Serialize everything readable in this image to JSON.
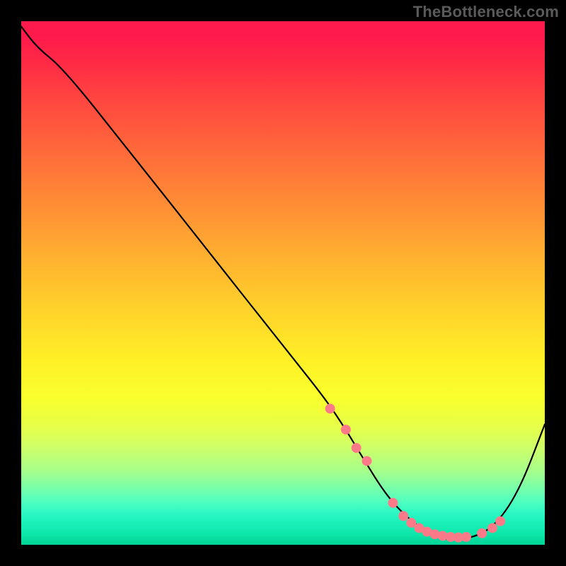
{
  "watermark": "TheBottleneck.com",
  "chart_data": {
    "type": "line",
    "title": "",
    "xlabel": "",
    "ylabel": "",
    "xlim": [
      0,
      100
    ],
    "ylim": [
      0,
      100
    ],
    "grid": false,
    "legend": false,
    "series": [
      {
        "name": "bottleneck-curve",
        "x": [
          0,
          3,
          8,
          20,
          35,
          50,
          58,
          62,
          65,
          70,
          75,
          80,
          85,
          90,
          95,
          100
        ],
        "y": [
          99,
          95,
          91,
          76,
          57,
          38,
          28,
          22,
          17,
          9,
          4,
          1,
          1,
          3,
          10,
          23
        ]
      }
    ],
    "markers": {
      "name": "highlight-points",
      "x": [
        59,
        62,
        64,
        66,
        71,
        73,
        74.5,
        76,
        77.5,
        79,
        80.5,
        82,
        83.5,
        85,
        88,
        90,
        91.5
      ],
      "y": [
        26,
        22,
        18.5,
        16,
        8,
        5.5,
        4.2,
        3.2,
        2.5,
        2,
        1.7,
        1.5,
        1.4,
        1.5,
        2.2,
        3.2,
        4.5
      ],
      "color": "#ff7a88",
      "radius": 7
    },
    "line_color": "#000000",
    "line_width": 2.2,
    "gradient_colors": {
      "top": "#ff1a4c",
      "mid": "#fff126",
      "bottom": "#02d696"
    }
  }
}
